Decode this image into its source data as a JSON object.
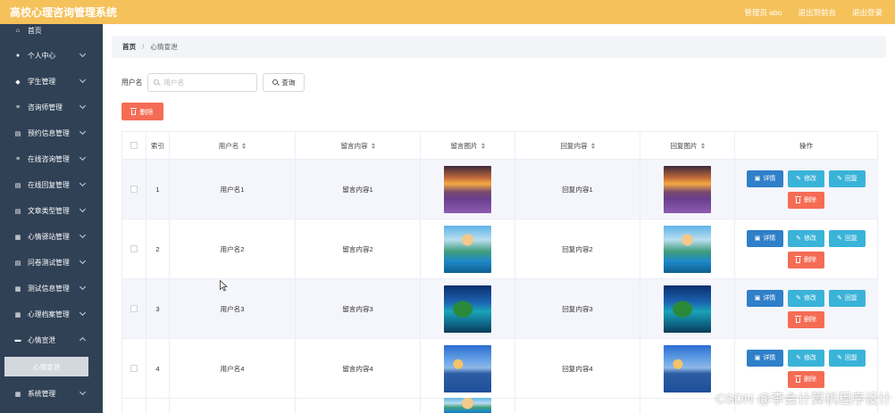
{
  "header": {
    "title": "高校心理咨询管理系统",
    "admin_label": "管理员 abo",
    "backend_link": "退出到前台",
    "logout_link": "退出登录",
    "bg_color": "#f5c15a"
  },
  "sidebar": {
    "bg_color": "#304156",
    "items": [
      {
        "label": "首页",
        "icon": "home-icon"
      },
      {
        "label": "个人中心",
        "icon": "user-icon"
      },
      {
        "label": "学生管理",
        "icon": "student-icon"
      },
      {
        "label": "咨询师管理",
        "icon": "list-icon"
      },
      {
        "label": "预约信息管理",
        "icon": "calendar-icon"
      },
      {
        "label": "在线咨询管理",
        "icon": "list-icon"
      },
      {
        "label": "在线回复管理",
        "icon": "list-icon"
      },
      {
        "label": "文章类型管理",
        "icon": "list-icon"
      },
      {
        "label": "心情驿站管理",
        "icon": "grid-icon"
      },
      {
        "label": "问卷测试管理",
        "icon": "grid-icon"
      },
      {
        "label": "测试信息管理",
        "icon": "grid-icon"
      },
      {
        "label": "心理档案管理",
        "icon": "grid-icon"
      },
      {
        "label": "心情宣泄",
        "icon": "mood-icon"
      }
    ],
    "active_sub": "心情宣泄",
    "last_item": {
      "label": "系统管理",
      "icon": "grid-icon"
    }
  },
  "breadcrumb": {
    "home": "首页",
    "separator": "/",
    "current": "心情宣泄"
  },
  "search": {
    "label": "用户名",
    "placeholder": "用户名",
    "button": "查询"
  },
  "batch_delete": "删除",
  "table": {
    "columns": [
      "索引",
      "用户名",
      "留言内容",
      "留言图片",
      "回复内容",
      "回复图片",
      "操作"
    ],
    "rows": [
      {
        "index": "1",
        "username": "用户名1",
        "message": "留言内容1",
        "reply": "回复内容1",
        "image": "sunset-lavender"
      },
      {
        "index": "2",
        "username": "用户名2",
        "message": "留言内容2",
        "reply": "回复内容2",
        "image": "pier-sea"
      },
      {
        "index": "3",
        "username": "用户名3",
        "message": "留言内容3",
        "reply": "回复内容3",
        "image": "island-sea"
      },
      {
        "index": "4",
        "username": "用户名4",
        "message": "留言内容4",
        "reply": "回复内容4",
        "image": "lake-sunset"
      }
    ],
    "actions": {
      "detail": "详情",
      "edit": "修改",
      "reply": "回复",
      "delete": "删除"
    }
  },
  "watermark": "CSDN @李会计算机程序设计"
}
